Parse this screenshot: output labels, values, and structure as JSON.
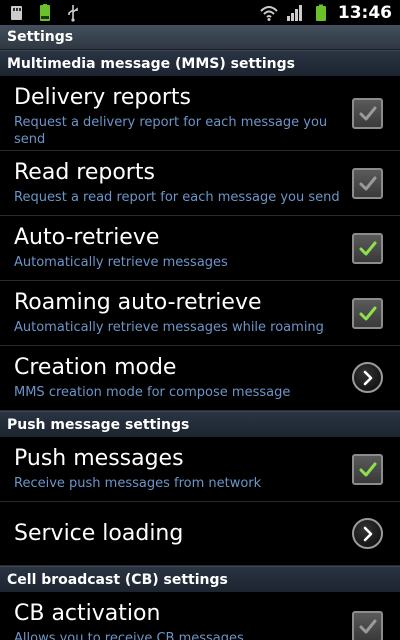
{
  "status_bar": {
    "time": "13:46",
    "icons": [
      "sd-card-icon",
      "battery-saver-icon",
      "usb-icon",
      "wifi-icon",
      "signal-icon",
      "battery-icon"
    ]
  },
  "title_bar": {
    "title": "Settings"
  },
  "sections": {
    "mms": {
      "header": "Multimedia message (MMS) settings",
      "items": [
        {
          "title": "Delivery reports",
          "subtitle": "Request a delivery report for each message you send",
          "control": "checkbox",
          "checked": false
        },
        {
          "title": "Read reports",
          "subtitle": "Request a read report for each message you send",
          "control": "checkbox",
          "checked": false
        },
        {
          "title": "Auto-retrieve",
          "subtitle": "Automatically retrieve messages",
          "control": "checkbox",
          "checked": true
        },
        {
          "title": "Roaming auto-retrieve",
          "subtitle": "Automatically retrieve messages while roaming",
          "control": "checkbox",
          "checked": true
        },
        {
          "title": "Creation mode",
          "subtitle": "MMS creation mode for compose message",
          "control": "chevron"
        }
      ]
    },
    "push": {
      "header": "Push message settings",
      "items": [
        {
          "title": "Push messages",
          "subtitle": "Receive push messages from network",
          "control": "checkbox",
          "checked": true
        },
        {
          "title": "Service loading",
          "control": "chevron"
        }
      ]
    },
    "cb": {
      "header": "Cell broadcast (CB) settings",
      "items": [
        {
          "title": "CB activation",
          "subtitle": "Allows you to receive CB messages",
          "control": "checkbox",
          "checked": false
        }
      ]
    }
  },
  "colors": {
    "subtitle": "#6b95c9",
    "check_green": "#8ee04a",
    "check_grey": "#9a9a9a"
  }
}
